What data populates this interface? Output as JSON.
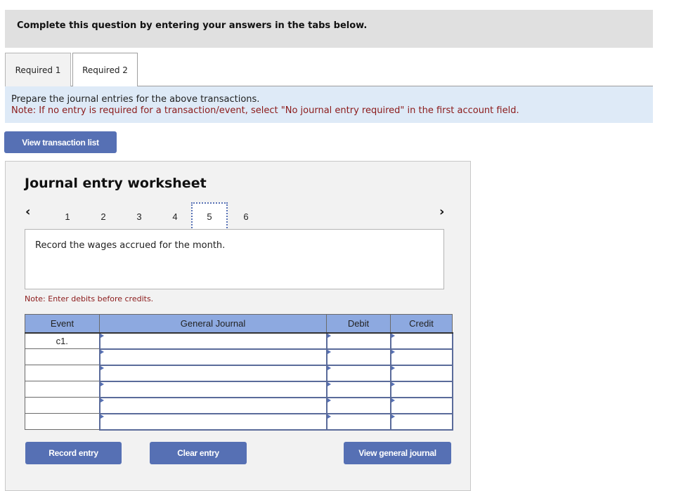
{
  "header": {
    "title": "Complete this question by entering your answers in the tabs below."
  },
  "tabs": [
    {
      "label": "Required 1",
      "active": false
    },
    {
      "label": "Required 2",
      "active": true
    }
  ],
  "instructions": {
    "line1": "Prepare the journal entries for the above transactions.",
    "line2": "Note: If no entry is required for a transaction/event, select \"No journal entry required\" in the first account field."
  },
  "buttons": {
    "view_transaction_list": "View transaction list",
    "record_entry": "Record entry",
    "clear_entry": "Clear entry",
    "view_general_journal": "View general journal"
  },
  "worksheet": {
    "title": "Journal entry worksheet",
    "pager": {
      "prev_icon": "‹",
      "next_icon": "›",
      "pages": [
        "1",
        "2",
        "3",
        "4",
        "5",
        "6"
      ],
      "active_page": "5"
    },
    "description": "Record the wages accrued for the month.",
    "note": "Note: Enter debits before credits.",
    "table": {
      "headers": [
        "Event",
        "General Journal",
        "Debit",
        "Credit"
      ],
      "rows": [
        {
          "event": "c1.",
          "account": "",
          "debit": "",
          "credit": ""
        },
        {
          "event": "",
          "account": "",
          "debit": "",
          "credit": ""
        },
        {
          "event": "",
          "account": "",
          "debit": "",
          "credit": ""
        },
        {
          "event": "",
          "account": "",
          "debit": "",
          "credit": ""
        },
        {
          "event": "",
          "account": "",
          "debit": "",
          "credit": ""
        },
        {
          "event": "",
          "account": "",
          "debit": "",
          "credit": ""
        }
      ]
    }
  },
  "colors": {
    "button": "#5670b4",
    "table_header": "#8da9e0",
    "note_text": "#8b1a1a",
    "instructions_bg": "#deeaf7"
  }
}
